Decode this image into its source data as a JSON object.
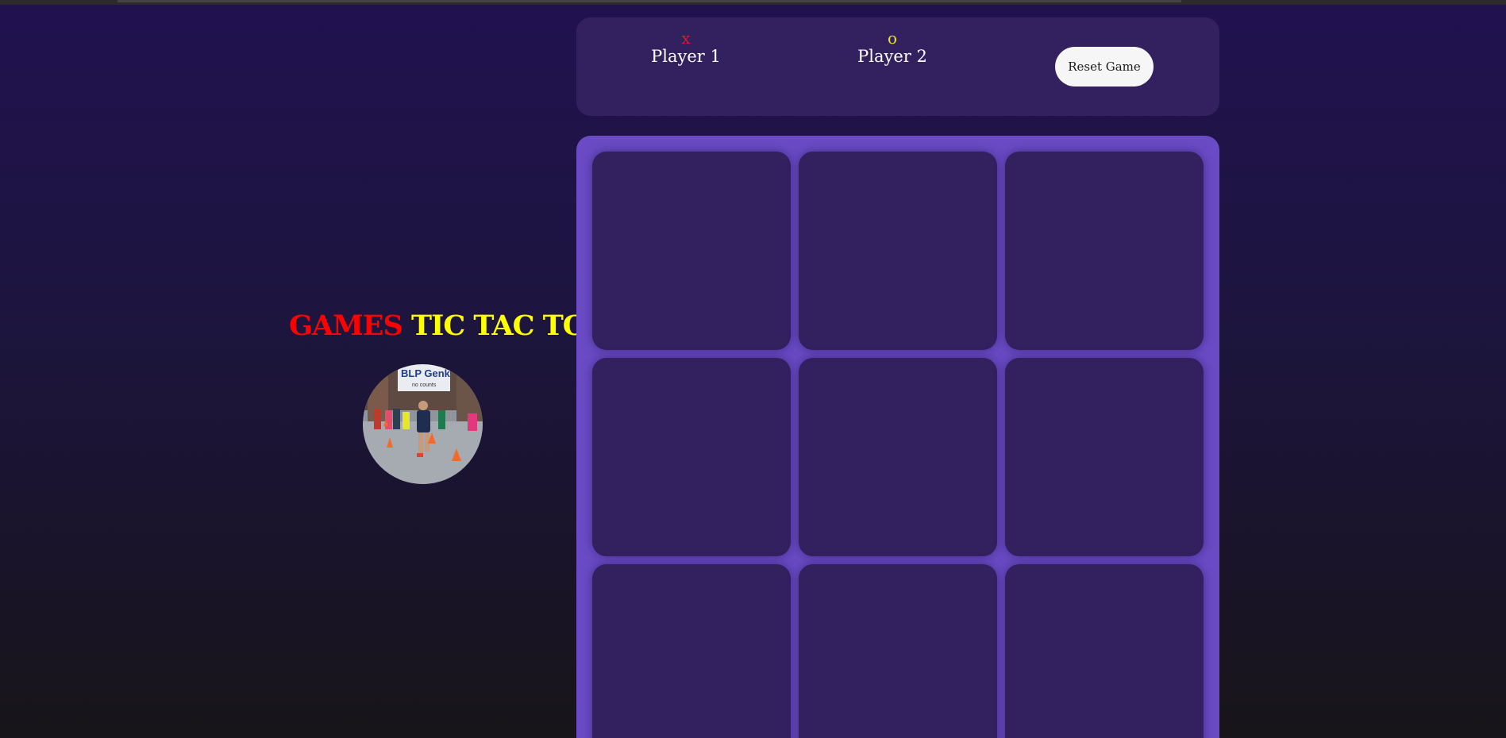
{
  "brand": {
    "word1": "GAMES",
    "word2": "TIC TAC TOE",
    "word1_color": "#ff0000",
    "word2_color": "#ffff00"
  },
  "avatar": {
    "alt": "Runner in a race photo",
    "banner_text": "BLP Genk",
    "banner_subtext": "no counts"
  },
  "scoreboard": {
    "player1": {
      "mark": "x",
      "name": "Player 1",
      "mark_color": "#e0182d"
    },
    "player2": {
      "mark": "o",
      "name": "Player 2",
      "mark_color": "#e8e31c"
    },
    "reset_label": "Reset Game"
  },
  "board": {
    "cells": [
      "",
      "",
      "",
      "",
      "",
      "",
      "",
      "",
      ""
    ]
  },
  "colors": {
    "panel": "#33215f",
    "board": "#6a4bc5",
    "button": "#f7f6f6"
  }
}
